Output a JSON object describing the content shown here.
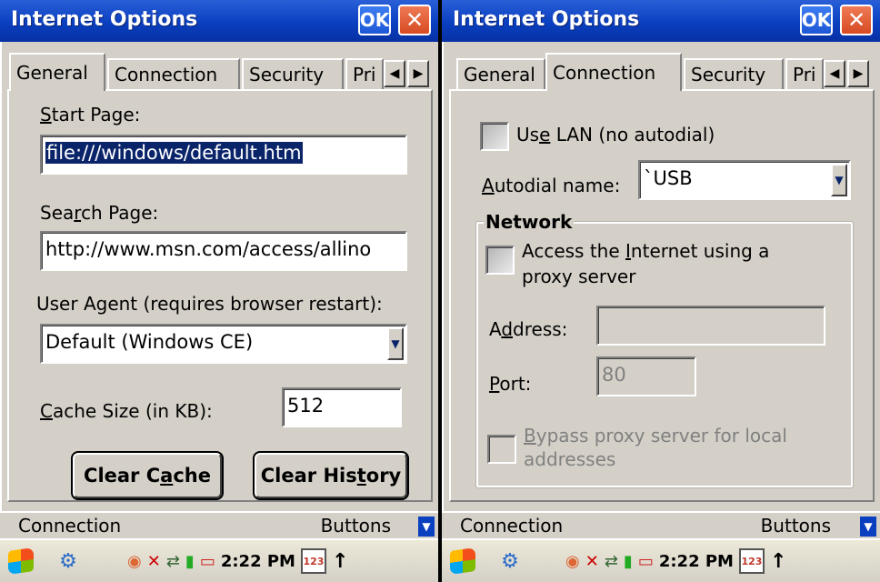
{
  "left": {
    "title": "Internet Options",
    "ok_label": "OK",
    "close_label": "✕",
    "tabs": [
      "General",
      "Connection",
      "Security",
      "Pri"
    ],
    "active_tab": "General",
    "start_page": {
      "label_u": "S",
      "label_rest": "tart Page:",
      "value": "file:///windows/default.htm"
    },
    "search_page": {
      "label_pre": "Sea",
      "label_u": "r",
      "label_rest": "ch Page:",
      "value": "http://www.msn.com/access/allino"
    },
    "user_agent": {
      "label": "User Agent (requires browser restart):",
      "selected": "Default (Windows CE)"
    },
    "cache_size": {
      "label_u": "C",
      "label_rest": "ache Size (in KB):",
      "value": "512"
    },
    "clear_cache": {
      "pre": "Clear C",
      "u": "a",
      "rest": "che"
    },
    "clear_history": {
      "pre": "Clear His",
      "u": "t",
      "rest": "ory"
    },
    "cmdbar": {
      "left": "Connection",
      "right": "Buttons"
    },
    "clock": "2:22 PM"
  },
  "right": {
    "title": "Internet Options",
    "ok_label": "OK",
    "close_label": "✕",
    "tabs": [
      "General",
      "Connection",
      "Security",
      "Pri"
    ],
    "active_tab": "Connection",
    "use_lan": {
      "pre": "Us",
      "u": "e",
      "rest": " LAN (no autodial)"
    },
    "autodial": {
      "label_u": "A",
      "label_rest": "utodial name:",
      "selected": "`USB"
    },
    "network_group": "Network",
    "proxy": {
      "line1_pre": "Access the ",
      "line1_u": "I",
      "line1_rest": "nternet using a",
      "line2": "proxy server"
    },
    "address": {
      "label_pre": "A",
      "label_u": "d",
      "label_rest": "dress:",
      "value": ""
    },
    "port": {
      "label_u": "P",
      "label_rest": "ort:",
      "value": "80"
    },
    "bypass": {
      "line1_u": "B",
      "line1_rest": "ypass proxy server for local",
      "line2": "addresses"
    },
    "cmdbar": {
      "left": "Connection",
      "right": "Buttons"
    },
    "clock": "2:22 PM"
  },
  "colors": {
    "titlebar": "#0a3fc0",
    "selection": "#0a246a",
    "dialog_bg": "#d4d0c8"
  }
}
